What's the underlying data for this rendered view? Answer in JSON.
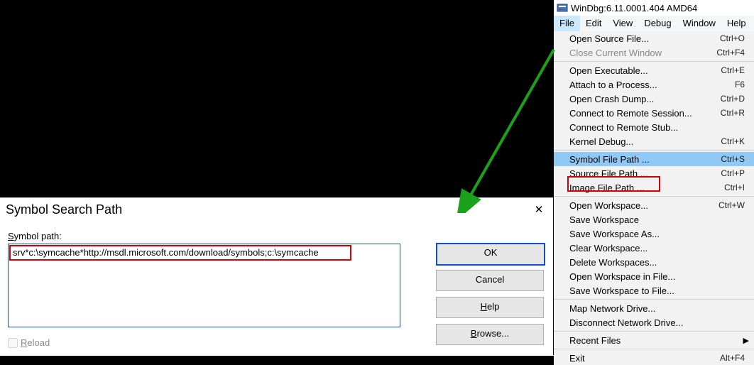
{
  "dialog": {
    "title": "Symbol Search Path",
    "label_path_u": "S",
    "label_path_rest": "ymbol path:",
    "path_value": "srv*c:\\symcache*http://msdl.microsoft.com/download/symbols;c:\\symcache",
    "ok": "OK",
    "cancel": "Cancel",
    "help_u": "H",
    "help_rest": "elp",
    "browse_u": "B",
    "browse_rest": "rowse...",
    "reload_u": "R",
    "reload_rest": "eload"
  },
  "windbg": {
    "title": "WinDbg:6.11.0001.404 AMD64",
    "menubar": [
      "File",
      "Edit",
      "View",
      "Debug",
      "Window",
      "Help"
    ],
    "menu": [
      {
        "type": "item",
        "label": "Open Source File...",
        "shortcut": "Ctrl+O"
      },
      {
        "type": "item",
        "label": "Close Current Window",
        "shortcut": "Ctrl+F4",
        "disabled": true
      },
      {
        "type": "sep"
      },
      {
        "type": "item",
        "label": "Open Executable...",
        "shortcut": "Ctrl+E"
      },
      {
        "type": "item",
        "label": "Attach to a Process...",
        "shortcut": "F6"
      },
      {
        "type": "item",
        "label": "Open Crash Dump...",
        "shortcut": "Ctrl+D"
      },
      {
        "type": "item",
        "label": "Connect to Remote Session...",
        "shortcut": "Ctrl+R"
      },
      {
        "type": "item",
        "label": "Connect to Remote Stub..."
      },
      {
        "type": "item",
        "label": "Kernel Debug...",
        "shortcut": "Ctrl+K"
      },
      {
        "type": "sep"
      },
      {
        "type": "item",
        "label": "Symbol File Path ...",
        "shortcut": "Ctrl+S",
        "highlight": true
      },
      {
        "type": "item",
        "label": "Source File Path ...",
        "shortcut": "Ctrl+P"
      },
      {
        "type": "item",
        "label": "Image File Path ...",
        "shortcut": "Ctrl+I"
      },
      {
        "type": "sep"
      },
      {
        "type": "item",
        "label": "Open Workspace...",
        "shortcut": "Ctrl+W"
      },
      {
        "type": "item",
        "label": "Save Workspace"
      },
      {
        "type": "item",
        "label": "Save Workspace As..."
      },
      {
        "type": "item",
        "label": "Clear Workspace..."
      },
      {
        "type": "item",
        "label": "Delete Workspaces..."
      },
      {
        "type": "item",
        "label": "Open Workspace in File..."
      },
      {
        "type": "item",
        "label": "Save Workspace to File..."
      },
      {
        "type": "sep"
      },
      {
        "type": "item",
        "label": "Map Network Drive..."
      },
      {
        "type": "item",
        "label": "Disconnect Network Drive..."
      },
      {
        "type": "sep"
      },
      {
        "type": "item",
        "label": "Recent Files",
        "submenu": true
      },
      {
        "type": "sep"
      },
      {
        "type": "item",
        "label": "Exit",
        "shortcut": "Alt+F4"
      }
    ]
  }
}
